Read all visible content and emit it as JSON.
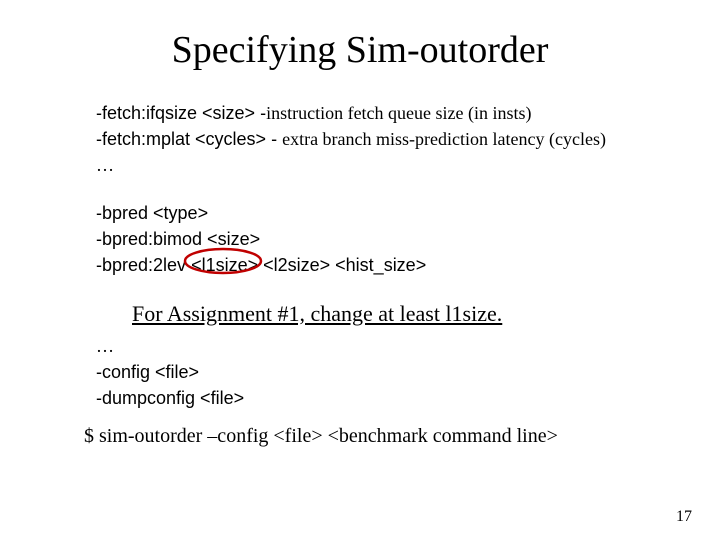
{
  "title": "Specifying Sim-outorder",
  "line1_cmd": "-fetch:ifqsize <size> -",
  "line1_desc": "instruction fetch queue size (in insts)",
  "line2_cmd": "-fetch:mplat <cycles> - ",
  "line2_desc": "extra branch miss-prediction latency (cycles)",
  "ellipsis1": "…",
  "bpred_l1": "-bpred <type>",
  "bpred_l2": "-bpred:bimod <size>",
  "bpred_l3_pre": "-bpred:2lev ",
  "bpred_l3_circ": "<l1size>",
  "bpred_l3_post": " <l2size> <hist_size>",
  "note": "For Assignment #1, change at least l1size.",
  "ellipsis2": "…",
  "cfg_l1": "-config <file>",
  "cfg_l2": "-dumpconfig <file>",
  "cmdline": "$ sim-outorder –config <file> <benchmark command line>",
  "page": "17"
}
